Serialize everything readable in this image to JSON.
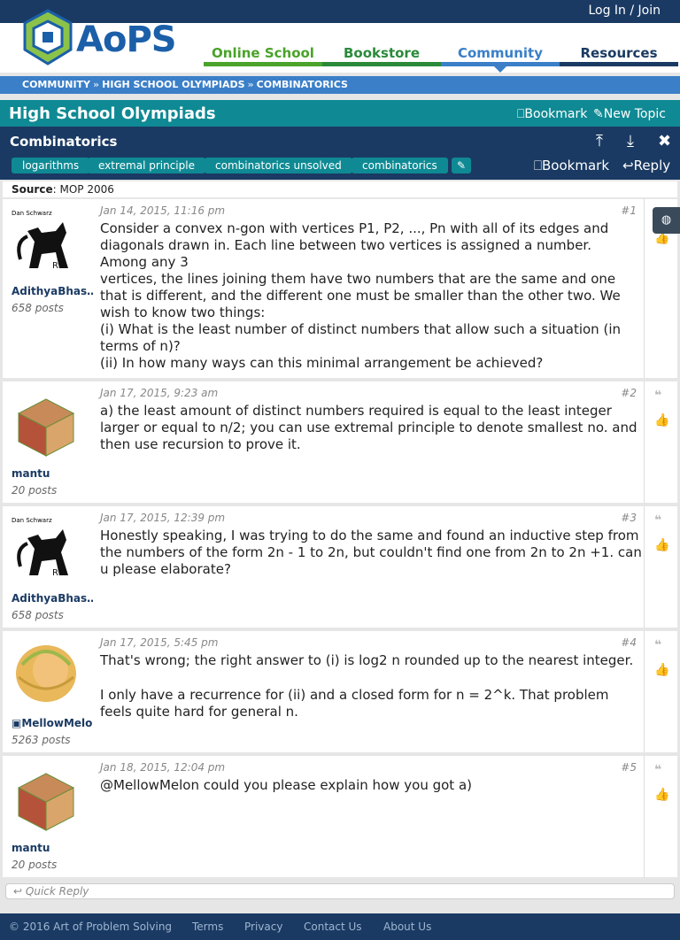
{
  "topbar": {
    "login_label": "Log In / Join"
  },
  "header": {
    "logo_text": "AoPS",
    "nav": [
      "Online School",
      "Bookstore",
      "Community",
      "Resources"
    ],
    "nav_colors": [
      "#4aa32a",
      "#2a8a3a",
      "#3a7fc8",
      "#1a3a63"
    ]
  },
  "breadcrumb": [
    "COMMUNITY",
    "HIGH SCHOOL OLYMPIADS",
    "COMBINATORICS"
  ],
  "forum": {
    "title": "High School Olympiads",
    "bookmark_label": "Bookmark",
    "new_topic_label": "New Topic"
  },
  "topic": {
    "title": "Combinatorics",
    "tags": [
      "logarithms",
      "extremal principle",
      "combinatorics unsolved",
      "combinatorics"
    ],
    "bookmark_label": "Bookmark",
    "reply_label": "Reply"
  },
  "source": {
    "label": "Source",
    "value": "MOP 2006"
  },
  "posts": [
    {
      "user": "AdithyaBhas…",
      "post_count": "658 posts",
      "date": "Jan 14, 2015, 11:16 pm",
      "number": "#1",
      "lines": [
        "Consider a convex n-gon with vertices P1, P2, ..., Pn with all of its edges and diagonals drawn in. Each line between two vertices is assigned a number. Among any 3",
        "vertices, the lines joining them have two numbers that are the same and one that is different, and the different one must be smaller than the other two. We wish to know two things:",
        "(i) What is the least number of distinct numbers that allow such a situation (in terms of n)?",
        "(ii) In how many ways can this minimal arrangement be achieved?"
      ]
    },
    {
      "user": "mantu",
      "post_count": "20 posts",
      "date": "Jan 17, 2015, 9:23 am",
      "number": "#2",
      "lines": [
        "a) the least amount of distinct numbers required is equal to the least integer larger or equal to n/2; you can use extremal principle to denote smallest no. and then use recursion to prove it."
      ]
    },
    {
      "user": "AdithyaBhas…",
      "post_count": "658 posts",
      "date": "Jan 17, 2015, 12:39 pm",
      "number": "#3",
      "lines": [
        "Honestly speaking, I was trying to do the same and found an inductive step from the numbers of the form 2n - 1 to 2n, but couldn't find one from 2n to 2n +1. can u please elaborate?"
      ]
    },
    {
      "user": "MellowMelon",
      "post_count": "5263 posts",
      "date": "Jan 17, 2015, 5:45 pm",
      "number": "#4",
      "lines": [
        "That's wrong; the right answer to (i) is log2 n rounded up to the nearest integer.",
        "I only have a recurrence for (ii) and a closed form for n = 2^k. That problem feels quite hard for general n."
      ]
    },
    {
      "user": "mantu",
      "post_count": "20 posts",
      "date": "Jan 18, 2015, 12:04 pm",
      "number": "#5",
      "lines": [
        "@MellowMelon could you please explain how you got a)"
      ]
    }
  ],
  "quick_reply_label": "Quick Reply",
  "footer": {
    "copyright": "© 2016 Art of Problem Solving",
    "links": [
      "Terms",
      "Privacy",
      "Contact Us",
      "About Us"
    ]
  }
}
